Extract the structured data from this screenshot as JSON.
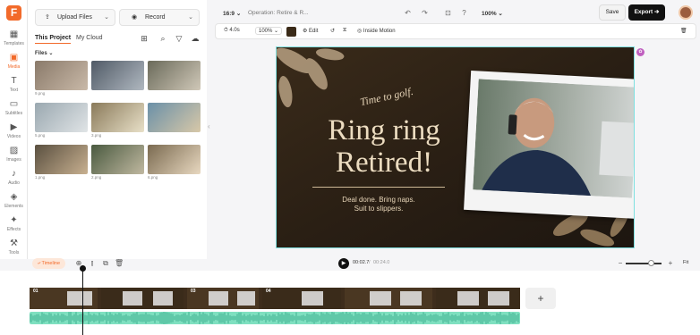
{
  "app": {
    "logo_letter": "F"
  },
  "rail": {
    "items": [
      {
        "label": "Templates",
        "icon": "templates-icon",
        "glyph": "▦"
      },
      {
        "label": "Media",
        "icon": "media-icon",
        "glyph": "▣",
        "active": true
      },
      {
        "label": "Text",
        "icon": "text-icon",
        "glyph": "T"
      },
      {
        "label": "Subtitles",
        "icon": "subtitles-icon",
        "glyph": "▭"
      },
      {
        "label": "Videos",
        "icon": "videos-icon",
        "glyph": "▶"
      },
      {
        "label": "Images",
        "icon": "images-icon",
        "glyph": "▨"
      },
      {
        "label": "Audio",
        "icon": "audio-icon",
        "glyph": "♪"
      },
      {
        "label": "Elements",
        "icon": "elements-icon",
        "glyph": "◈"
      },
      {
        "label": "Effects",
        "icon": "effects-icon",
        "glyph": "✦"
      },
      {
        "label": "Tools",
        "icon": "tools-icon",
        "glyph": "⚒"
      }
    ]
  },
  "panel": {
    "upload_label": "Upload Files",
    "record_label": "Record",
    "tabs": [
      "This Project",
      "My Cloud"
    ],
    "files_label": "Files",
    "thumbs": [
      {
        "cap": "9.png",
        "colors": [
          "#8a7a6a",
          "#c9b9a8"
        ]
      },
      {
        "cap": "",
        "colors": [
          "#505a66",
          "#b0b8c0"
        ]
      },
      {
        "cap": "",
        "colors": [
          "#6a6a5a",
          "#d0c8b8"
        ]
      },
      {
        "cap": "5.png",
        "colors": [
          "#9aa8b0",
          "#e0e4e6"
        ]
      },
      {
        "cap": "3.png",
        "colors": [
          "#8a7a5a",
          "#e8e0c8"
        ]
      },
      {
        "cap": "",
        "colors": [
          "#6a90a8",
          "#d8c8a8"
        ]
      },
      {
        "cap": "1.png",
        "colors": [
          "#5a5040",
          "#c8b090"
        ]
      },
      {
        "cap": "2.png",
        "colors": [
          "#4a5a40",
          "#c0b8a0"
        ]
      },
      {
        "cap": "6.png",
        "colors": [
          "#7a6a50",
          "#e8d8c0"
        ]
      }
    ]
  },
  "topbar": {
    "aspect": "16:9",
    "project_name": "Operation: Retire & R...",
    "zoom": "100%",
    "save_label": "Save",
    "export_label": "Export"
  },
  "toolbar2": {
    "duration": "4.0s",
    "scale": "100%",
    "edit_label": "Edit",
    "motion_label": "Inside Motion"
  },
  "canvas": {
    "script_text": "Time to golf.",
    "title_line1": "Ring ring",
    "title_line2": "Retired!",
    "subtitle_line1": "Deal done. Bring naps.",
    "subtitle_line2": "Suit to slippers."
  },
  "timeline": {
    "label": "Timeline",
    "current_time": "00:02.7",
    "separator": "/",
    "total_time": "00:24.0",
    "fit_label": "Fit",
    "clip_numbers": [
      "01",
      "03",
      "04"
    ],
    "add_label": "+"
  }
}
